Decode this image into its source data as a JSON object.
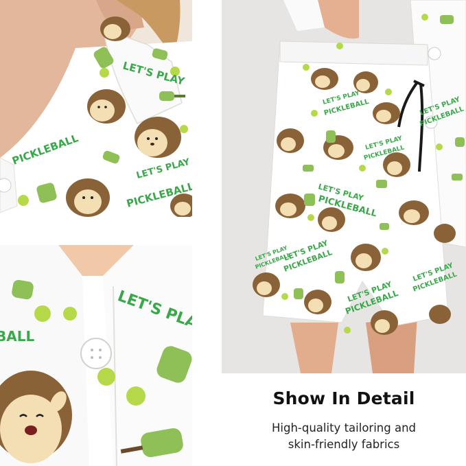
{
  "caption": {
    "title": "Show In Detail",
    "subtitle_line1": "High-quality tailoring and",
    "subtitle_line2": "skin-friendly fabrics"
  },
  "fabric_print": {
    "slogan_line1": "LET'S PLAY",
    "slogan_line2": "PICKLEBALL",
    "partial_text_top_left": "LET'S PLAY",
    "partial_text_bottom_left": "BALL",
    "colors": {
      "fabric": "#ffffff",
      "slogan_green": "#3aa84a",
      "paddle_green": "#8fbf57",
      "ball_green": "#b6d94a",
      "hedgehog_spikes": "#8a6238",
      "hedgehog_face": "#f3dfb3"
    }
  },
  "photos": {
    "top_left": "collar-closeup",
    "bottom_left": "button-closeup",
    "right": "shorts-on-model"
  },
  "icons": [
    "hedgehog-icon",
    "pickleball-paddle-icon",
    "pickleball-icon",
    "button-icon",
    "drawstring-icon"
  ]
}
